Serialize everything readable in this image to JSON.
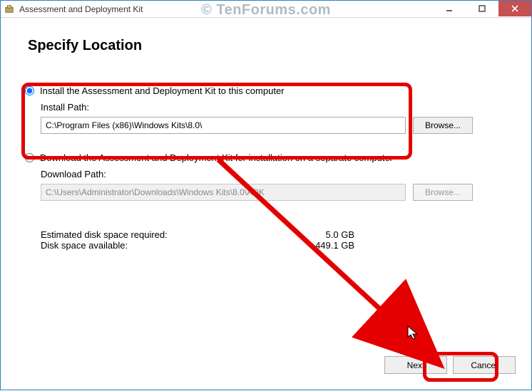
{
  "titlebar": {
    "title": "Assessment and Deployment Kit"
  },
  "watermark": "© TenForums.com",
  "heading": "Specify Location",
  "options": {
    "install": {
      "label": "Install the Assessment and Deployment Kit to this computer",
      "selected": true,
      "pathLabel": "Install Path:",
      "pathValue": "C:\\Program Files (x86)\\Windows Kits\\8.0\\",
      "browse": "Browse..."
    },
    "download": {
      "label": "Download the Assessment and Deployment Kit for installation on a separate computer",
      "selected": false,
      "pathLabel": "Download Path:",
      "pathValue": "C:\\Users\\Administrator\\Downloads\\Windows Kits\\8.0\\ADK",
      "browse": "Browse..."
    }
  },
  "disk": {
    "reqLabel": "Estimated disk space required:",
    "reqVal": "5.0 GB",
    "availLabel": "Disk space available:",
    "availVal": "449.1 GB"
  },
  "footer": {
    "next": "Next",
    "cancel": "Cancel"
  }
}
